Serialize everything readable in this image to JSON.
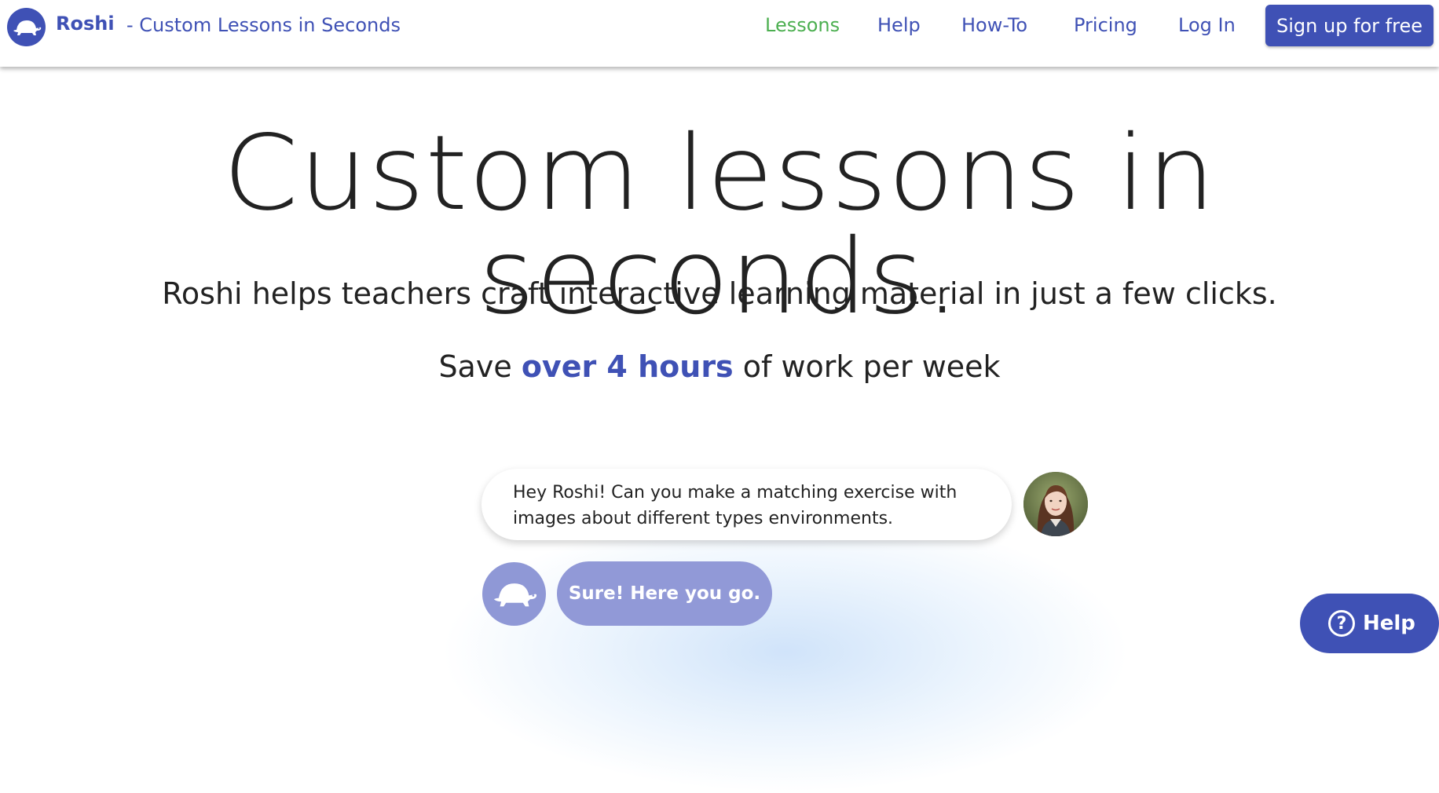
{
  "header": {
    "brand_name": "Roshi",
    "brand_tagline": "- Custom Lessons in Seconds",
    "logo_icon": "turtle-icon",
    "nav": [
      {
        "label": "Lessons",
        "active": true
      },
      {
        "label": "Help",
        "active": false
      },
      {
        "label": "How-To",
        "active": false
      },
      {
        "label": "Pricing",
        "active": false
      },
      {
        "label": "Log In",
        "active": false
      }
    ],
    "signup_label": "Sign up for free"
  },
  "hero": {
    "title": "Custom lessons in seconds.",
    "subtitle": "Roshi helps teachers craft interactive learning material in just a few clicks.",
    "savings_prefix": "Save",
    "savings_highlight": "over 4 hours",
    "savings_suffix": "of work per week"
  },
  "chat": {
    "user_message": "Hey Roshi! Can you make a matching exercise with images about different types environments.",
    "roshi_reply": "Sure! Here you go."
  },
  "help_fab": {
    "label": "Help",
    "icon_glyph": "?"
  },
  "colors": {
    "brand": "#3f51b5",
    "active_nav": "#4caf50",
    "reply_bubble": "#9199d7"
  }
}
